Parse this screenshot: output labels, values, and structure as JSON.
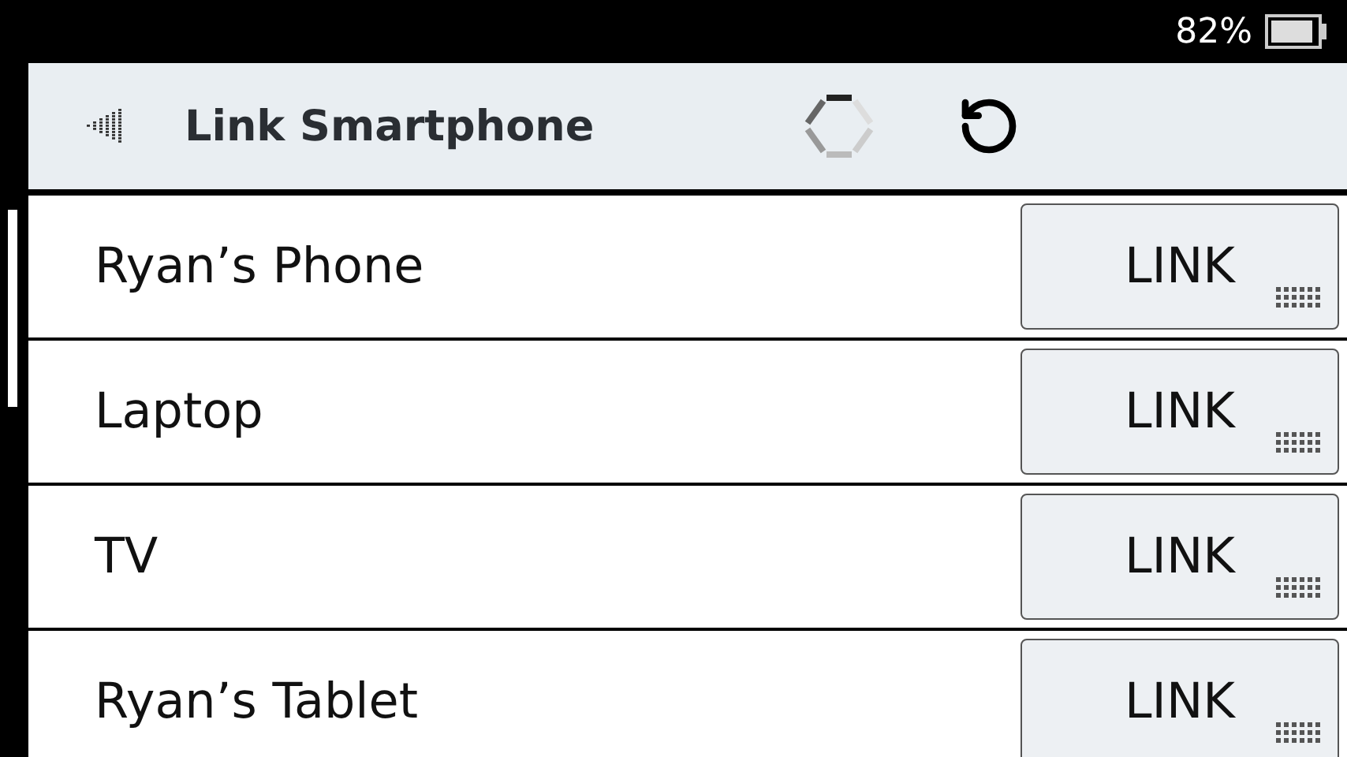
{
  "status_bar": {
    "battery": "82%"
  },
  "header": {
    "title": "Link Smartphone"
  },
  "devices": [
    {
      "name": "Ryan’s Phone",
      "button": "LINK"
    },
    {
      "name": "Laptop",
      "button": "LINK"
    },
    {
      "name": "TV",
      "button": "LINK"
    },
    {
      "name": "Ryan’s Tablet",
      "button": "LINK"
    }
  ]
}
